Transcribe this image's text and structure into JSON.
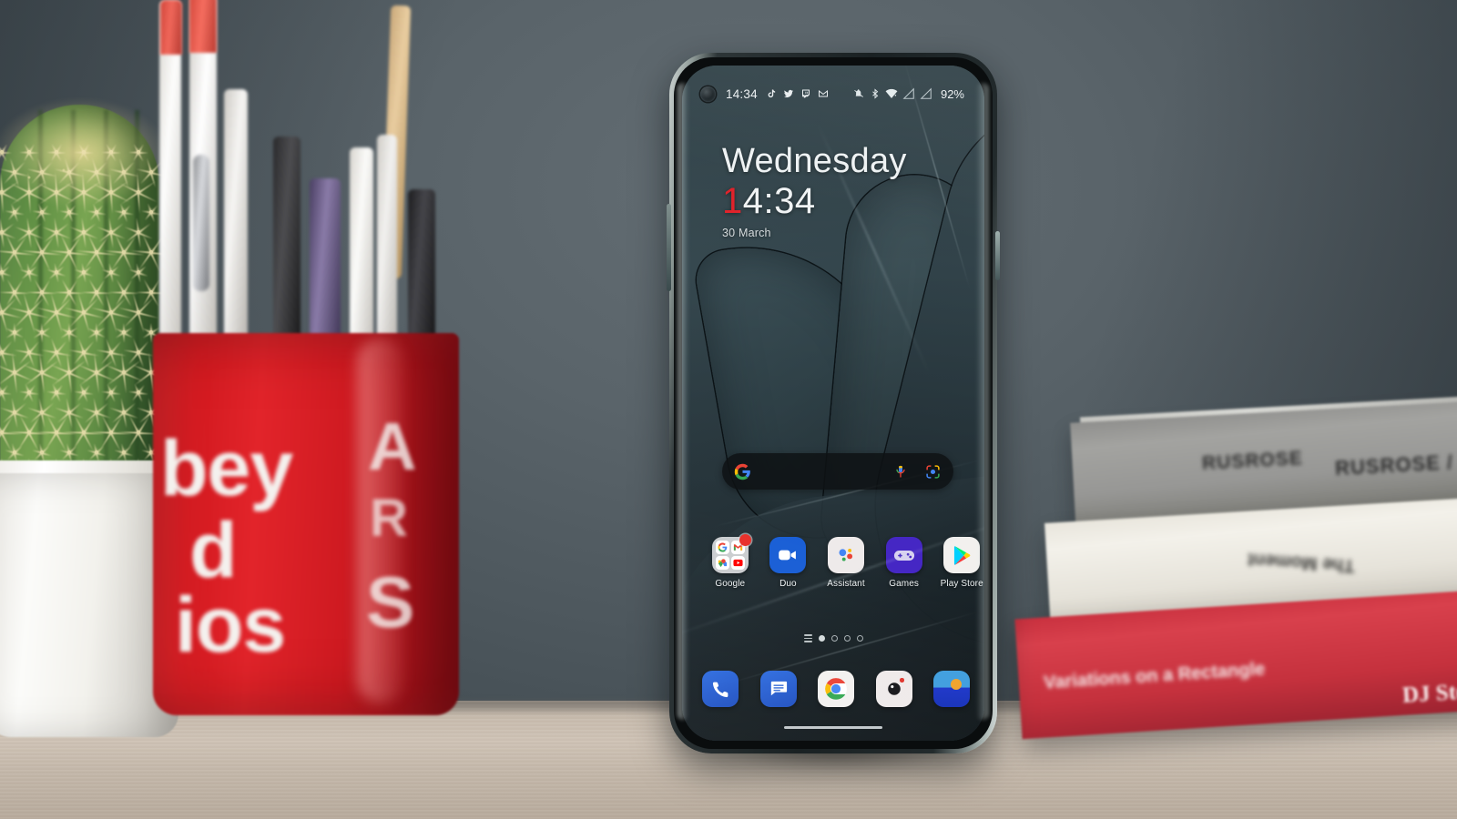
{
  "scene": {
    "description": "OnePlus smartphone on a wooden desk showing Android home screen",
    "background_color": "#5b6469",
    "desk_color": "#c8bcae"
  },
  "phone": {
    "status_bar": {
      "time": "14:34",
      "battery_percent": "92%",
      "left_icons": [
        "tiktok-icon",
        "twitter-icon",
        "twitch-icon",
        "gmail-icon"
      ],
      "right_icons": [
        "notifications-silenced-icon",
        "bluetooth-icon",
        "wifi-icon",
        "signal-sim1-icon",
        "signal-sim2-icon"
      ]
    },
    "clock_widget": {
      "day": "Wednesday",
      "time_accent": "1",
      "time_rest": "4:34",
      "date": "30 March",
      "accent_color": "#e0232b"
    },
    "search_bar": {
      "logo": "google-g-icon",
      "mic": "microphone-icon",
      "lens": "google-lens-icon",
      "placeholder": ""
    },
    "apps": [
      {
        "label": "Google",
        "icon": "google-folder-icon",
        "badge": true,
        "folder_items": [
          "google-search-icon",
          "gmail-icon",
          "google-maps-icon",
          "youtube-icon"
        ]
      },
      {
        "label": "Duo",
        "icon": "google-duo-icon",
        "badge": false
      },
      {
        "label": "Assistant",
        "icon": "google-assistant-icon",
        "badge": false
      },
      {
        "label": "Games",
        "icon": "google-play-games-icon",
        "badge": false
      },
      {
        "label": "Play Store",
        "icon": "google-play-store-icon",
        "badge": false
      }
    ],
    "page_indicator": {
      "menu_icon": "app-drawer-lines-icon",
      "total_pages": 4,
      "active_page": 1
    },
    "dock": [
      {
        "label": "Phone",
        "icon": "phone-icon"
      },
      {
        "label": "Messages",
        "icon": "messages-icon"
      },
      {
        "label": "Chrome",
        "icon": "chrome-icon"
      },
      {
        "label": "Camera",
        "icon": "camera-icon"
      },
      {
        "label": "Weather",
        "icon": "weather-icon"
      }
    ],
    "navigation": {
      "gesture_bar": "gesture-navigation-bar"
    }
  },
  "desk_objects": {
    "cactus": {
      "name": "cactus-plant",
      "pot": "white-ceramic-pot"
    },
    "pen_cup": {
      "name": "red-pen-cup",
      "text_lines": [
        "bey",
        "d",
        "ios",
        "A",
        "R",
        "S"
      ]
    },
    "books": [
      {
        "name": "gray-book",
        "spine_text_left": "RUSROSE",
        "spine_text_right": "RUSROSE / HARRIS"
      },
      {
        "name": "cream-book",
        "spine_text": "The Moment"
      },
      {
        "name": "red-book",
        "spine_text": "Variations on a Rectangle",
        "author": "DJ Stout"
      }
    ]
  }
}
